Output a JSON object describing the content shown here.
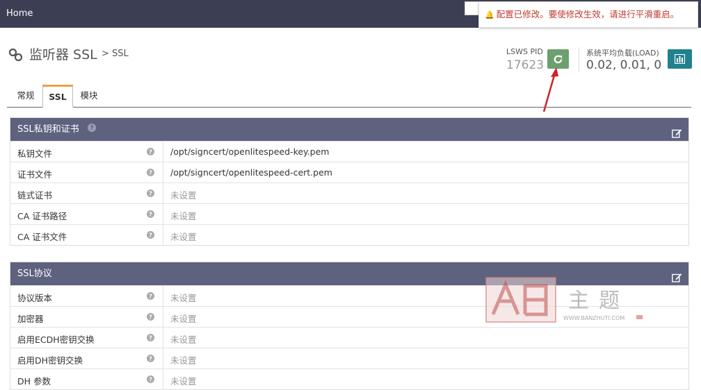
{
  "topbar": {
    "home_label": "Home"
  },
  "notice": {
    "text": "配置已修改。要使修改生效，请进行平滑重启。",
    "icon": "bell-icon"
  },
  "header": {
    "title": "监听器 SSL",
    "breadcrumb": "> SSL",
    "pid_label": "LSWS PID",
    "pid_value": "17623",
    "load_label": "系统平均负载(LOAD)",
    "load_value": "0.02, 0.01, 0"
  },
  "tabs": [
    {
      "label": "常规"
    },
    {
      "label": "SSL"
    },
    {
      "label": "模块"
    }
  ],
  "panels": [
    {
      "title": "SSL私钥和证书",
      "rows": [
        {
          "label": "私钥文件",
          "value": "/opt/signcert/openlitespeed-key.pem"
        },
        {
          "label": "证书文件",
          "value": "/opt/signcert/openlitespeed-cert.pem"
        },
        {
          "label": "链式证书",
          "value": "未设置"
        },
        {
          "label": "CA 证书路径",
          "value": "未设置"
        },
        {
          "label": "CA 证书文件",
          "value": "未设置"
        }
      ]
    },
    {
      "title": "SSL协议",
      "rows": [
        {
          "label": "协议版本",
          "value": "未设置"
        },
        {
          "label": "加密器",
          "value": "未设置"
        },
        {
          "label": "启用ECDH密钥交换",
          "value": "未设置"
        },
        {
          "label": "启用DH密钥交换",
          "value": "未设置"
        },
        {
          "label": "DH 参数",
          "value": "未设置"
        }
      ]
    }
  ],
  "watermark": {
    "text": "主题",
    "url": "WWW.BANZHUTI.COM"
  },
  "colors": {
    "topbar": "#3c3f54",
    "panel_header": "#5e627f",
    "reload_button": "#6e9f6e",
    "chart_button": "#21818f",
    "notice_text": "#c0392b",
    "tab_accent": "#e6a14a",
    "arrow": "#d0202a"
  }
}
